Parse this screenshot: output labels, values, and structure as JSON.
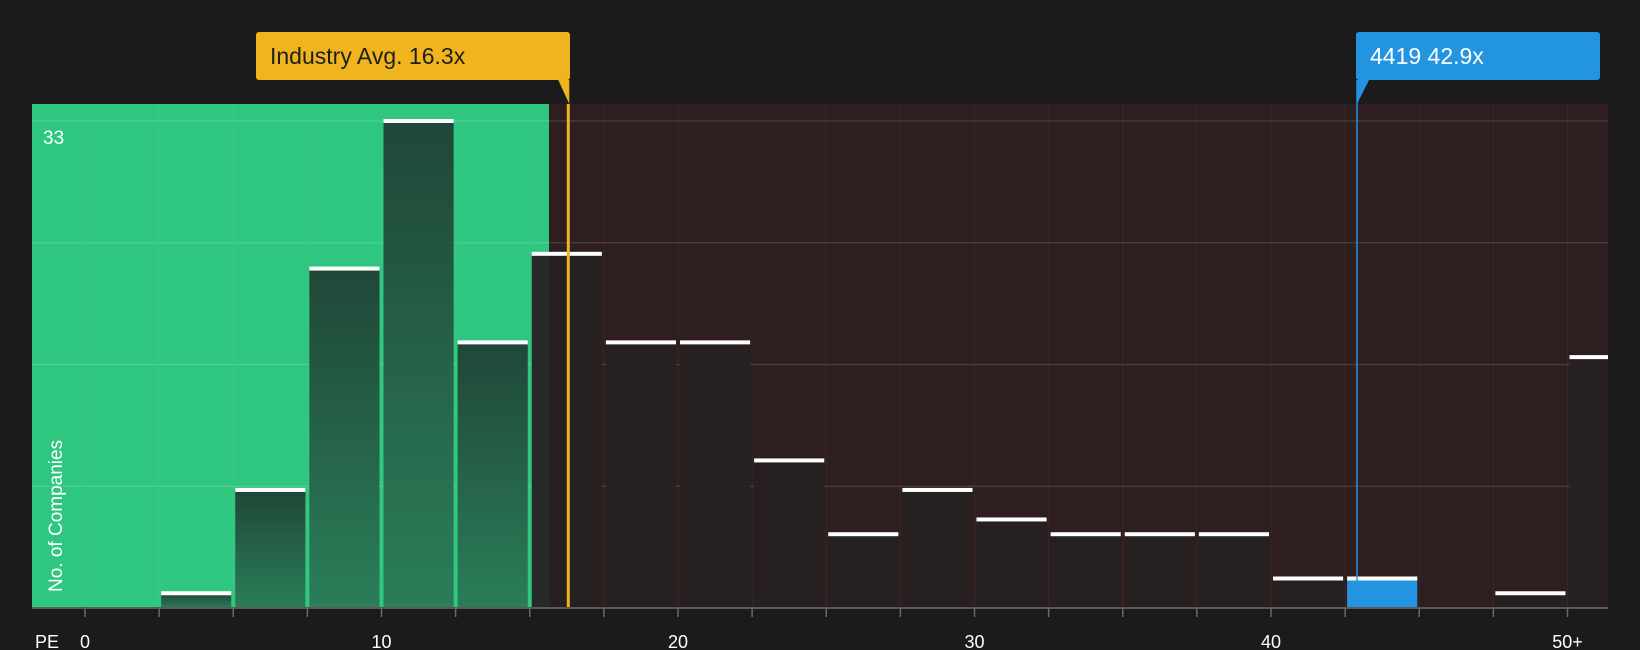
{
  "chart_data": {
    "type": "bar",
    "title": "",
    "xlabel": "PE",
    "ylabel": "No. of Companies",
    "y_max_label": "33",
    "ylim": [
      0,
      33
    ],
    "xlim": [
      0,
      51.5
    ],
    "x_ticks": [
      {
        "value": 0,
        "label": "0"
      },
      {
        "value": 10,
        "label": "10"
      },
      {
        "value": 20,
        "label": "20"
      },
      {
        "value": 30,
        "label": "30"
      },
      {
        "value": 40,
        "label": "40"
      },
      {
        "value": 50,
        "label": "50+"
      }
    ],
    "bin_width": 2.5,
    "bins": [
      {
        "start": 0,
        "value": 0
      },
      {
        "start": 2.5,
        "value": 1
      },
      {
        "start": 5,
        "value": 8
      },
      {
        "start": 7.5,
        "value": 23
      },
      {
        "start": 10,
        "value": 33
      },
      {
        "start": 12.5,
        "value": 18
      },
      {
        "start": 15,
        "value": 24
      },
      {
        "start": 17.5,
        "value": 18
      },
      {
        "start": 20,
        "value": 18
      },
      {
        "start": 22.5,
        "value": 10
      },
      {
        "start": 25,
        "value": 5
      },
      {
        "start": 27.5,
        "value": 8
      },
      {
        "start": 30,
        "value": 6
      },
      {
        "start": 32.5,
        "value": 5
      },
      {
        "start": 35,
        "value": 5
      },
      {
        "start": 37.5,
        "value": 5
      },
      {
        "start": 40,
        "value": 2
      },
      {
        "start": 42.5,
        "value": 2,
        "highlight": true
      },
      {
        "start": 45,
        "value": 0
      },
      {
        "start": 47.5,
        "value": 1
      },
      {
        "start": 50,
        "value": 17
      }
    ],
    "industry_avg": {
      "value": 16.3,
      "label": "Industry Avg. 16.3x"
    },
    "company": {
      "value": 42.9,
      "label": "4419 42.9x"
    },
    "colors": {
      "background": "#1b1b1b",
      "undervalued_zone": "#2fc77f",
      "overvalued_zone": "#2e1e1f",
      "bar_in_zone": "#22473a",
      "bar_out_zone": "#262121",
      "bar_highlight": "#2394e0",
      "bar_cap": "#ffffff",
      "industry": "#efb41e",
      "company": "#2394e0"
    }
  }
}
